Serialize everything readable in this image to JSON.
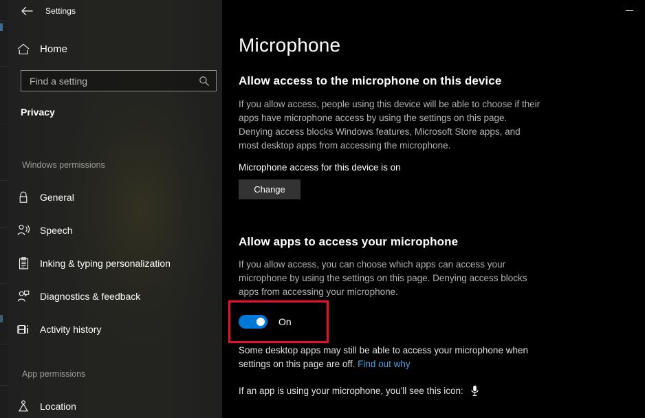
{
  "window": {
    "title": "Settings",
    "back_icon": "back-arrow-icon",
    "minimize_label": "Minimize"
  },
  "sidebar": {
    "home": {
      "label": "Home",
      "icon": "home-icon"
    },
    "search": {
      "placeholder": "Find a setting",
      "value": "",
      "icon": "search-icon"
    },
    "category": "Privacy",
    "groups": [
      {
        "header": "Windows permissions",
        "items": [
          {
            "label": "General",
            "icon": "lock-icon"
          },
          {
            "label": "Speech",
            "icon": "speech-person-icon"
          },
          {
            "label": "Inking & typing personalization",
            "icon": "clipboard-icon"
          },
          {
            "label": "Diagnostics & feedback",
            "icon": "person-feedback-icon"
          },
          {
            "label": "Activity history",
            "icon": "activity-history-icon"
          }
        ]
      },
      {
        "header": "App permissions",
        "items": [
          {
            "label": "Location",
            "icon": "location-pin-icon"
          }
        ]
      }
    ]
  },
  "main": {
    "page_title": "Microphone",
    "device_section": {
      "heading": "Allow access to the microphone on this device",
      "body": "If you allow access, people using this device will be able to choose if their apps have microphone access by using the settings on this page. Denying access blocks Windows features, Microsoft Store apps, and most desktop apps from accessing the microphone.",
      "status": "Microphone access for this device is on",
      "change_button": "Change"
    },
    "apps_section": {
      "heading": "Allow apps to access your microphone",
      "body": "If you allow access, you can choose which apps can access your microphone by using the settings on this page. Denying access blocks apps from accessing your microphone.",
      "toggle_state": "On",
      "note_prefix": "Some desktop apps may still be able to access your microphone when settings on this page are off. ",
      "note_link": "Find out why",
      "icon_note": "If an app is using your microphone, you'll see this icon:",
      "icon_name": "microphone-icon"
    }
  },
  "colors": {
    "accent": "#0078d7",
    "highlight": "#e8112d",
    "link": "#4ca0e0",
    "sidebar_bg": "#232320",
    "content_bg": "#000000"
  }
}
